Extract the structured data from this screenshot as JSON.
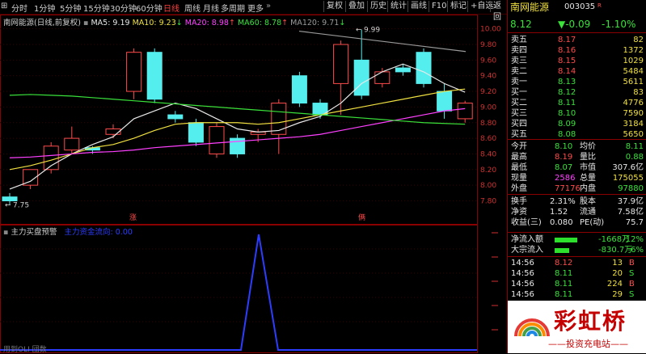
{
  "toolbar": {
    "periods": [
      "分时",
      "1分钟",
      "5分钟",
      "15分钟",
      "30分钟",
      "60分钟",
      "日线",
      "周线",
      "月线",
      "多周期",
      "更多"
    ],
    "active_period": "日线",
    "buttons": [
      "复权",
      "叠加",
      "历史",
      "统计",
      "画线",
      "F10",
      "标记",
      "+自选",
      "返回"
    ]
  },
  "main_chart": {
    "title": "南网能源(日线,前复权)",
    "ma_labels": [
      {
        "text": "MA5: 9.19",
        "color": "#e8e8e8"
      },
      {
        "text": "MA10: 9.23",
        "color": "#f0e040"
      },
      {
        "text": "MA20: 8.98",
        "color": "#ff40ff"
      },
      {
        "text": "MA60: 8.78",
        "color": "#3ae23a"
      },
      {
        "text": "MA120: 9.71",
        "color": "#9a9a9a"
      }
    ],
    "y_ticks": [
      "10.00",
      "9.80",
      "9.60",
      "9.40",
      "9.20",
      "9.00",
      "8.80",
      "8.60",
      "8.40",
      "8.20",
      "8.00",
      "7.80"
    ],
    "high_annotation": "9.99",
    "low_annotation": "7.75",
    "markers": [
      "涨",
      "俩"
    ]
  },
  "sub_chart": {
    "title": "主力买盘预警",
    "series_label": "主力资金流向: 0.00",
    "footer": "用到OLI 団数"
  },
  "panel": {
    "name": "南网能源",
    "code": "003035",
    "price": "8.12",
    "change": "▼-0.09",
    "change_pct": "-1.10%",
    "order_book": [
      {
        "label": "卖五",
        "price": "8.17",
        "vol": "82",
        "side": "sell"
      },
      {
        "label": "卖四",
        "price": "8.16",
        "vol": "1372",
        "side": "sell"
      },
      {
        "label": "卖三",
        "price": "8.15",
        "vol": "1029",
        "side": "sell"
      },
      {
        "label": "卖二",
        "price": "8.14",
        "vol": "5484",
        "side": "sell"
      },
      {
        "label": "卖一",
        "price": "8.13",
        "vol": "5611",
        "side": "sell"
      },
      {
        "label": "买一",
        "price": "8.12",
        "vol": "83",
        "side": "buy"
      },
      {
        "label": "买二",
        "price": "8.11",
        "vol": "4776",
        "side": "buy"
      },
      {
        "label": "买三",
        "price": "8.10",
        "vol": "7590",
        "side": "buy"
      },
      {
        "label": "买四",
        "price": "8.09",
        "vol": "3184",
        "side": "buy"
      },
      {
        "label": "买五",
        "price": "8.08",
        "vol": "5650",
        "side": "buy"
      }
    ],
    "stats": [
      {
        "l1": "今开",
        "v1": "8.10",
        "c1": "green",
        "l2": "均价",
        "v2": "8.11",
        "c2": "green"
      },
      {
        "l1": "最高",
        "v1": "8.19",
        "c1": "red",
        "l2": "量比",
        "v2": "0.88",
        "c2": "green"
      },
      {
        "l1": "最低",
        "v1": "8.07",
        "c1": "green",
        "l2": "市值",
        "v2": "307.6亿",
        "c2": "white"
      },
      {
        "l1": "现量",
        "v1": "2586",
        "c1": "purple",
        "l2": "总量",
        "v2": "175055",
        "c2": "yellow"
      },
      {
        "l1": "外盘",
        "v1": "77176",
        "c1": "red",
        "l2": "内盘",
        "v2": "97880",
        "c2": "green"
      }
    ],
    "fundamentals": [
      {
        "l1": "换手",
        "v1": "2.31%",
        "l2": "股本",
        "v2": "37.9亿"
      },
      {
        "l1": "净资",
        "v1": "1.52",
        "l2": "流通",
        "v2": "7.58亿"
      },
      {
        "l1": "收益(三)",
        "v1": "0.080",
        "l2": "PE(动)",
        "v2": "75.7"
      }
    ],
    "flows": [
      {
        "label": "净流入额",
        "value": "-1668万",
        "pct": "-12%",
        "bar": 0.55
      },
      {
        "label": "大宗流入",
        "value": "-830.7万",
        "pct": "-6%",
        "bar": 0.35
      }
    ],
    "ticks": [
      {
        "time": "14:56",
        "price": "8.12",
        "vol": "13",
        "flag": "B"
      },
      {
        "time": "14:56",
        "price": "8.11",
        "vol": "20",
        "flag": "S"
      },
      {
        "time": "14:56",
        "price": "8.11",
        "vol": "224",
        "flag": "B"
      },
      {
        "time": "14:56",
        "price": "8.11",
        "vol": "29",
        "flag": "S"
      }
    ],
    "watermark_main": "彩虹桥",
    "watermark_sub": "投资充电站"
  },
  "colors": {
    "up": "#ff4b4b",
    "down": "#3ae23a",
    "bull_fill": "#000000",
    "bear_fill": "#55eeee",
    "ma5": "#e8e8e8",
    "ma10": "#f0e040",
    "ma20": "#ff40ff",
    "ma60": "#3ae23a",
    "ma120": "#9a9a9a",
    "sub_line": "#2d3dff"
  }
}
